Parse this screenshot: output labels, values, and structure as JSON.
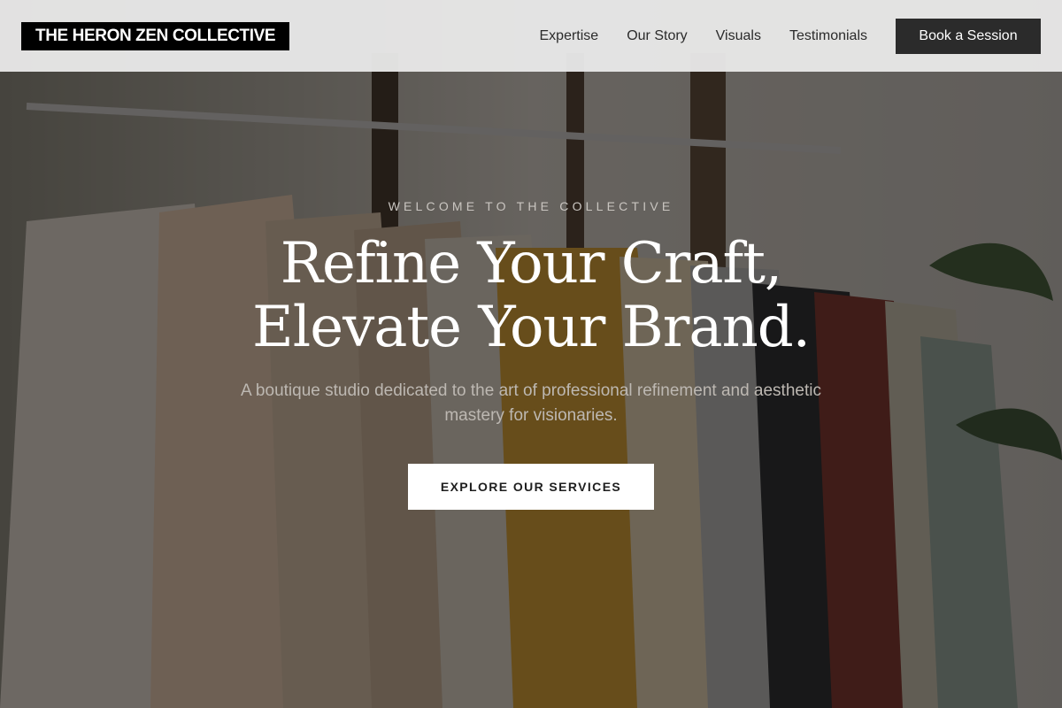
{
  "header": {
    "logo": "THE HERON ZEN COLLECTIVE",
    "nav": [
      {
        "label": "Expertise"
      },
      {
        "label": "Our Story"
      },
      {
        "label": "Visuals"
      },
      {
        "label": "Testimonials"
      }
    ],
    "cta_label": "Book a Session"
  },
  "hero": {
    "eyebrow": "WELCOME TO THE COLLECTIVE",
    "headline_line1": "Refine Your Craft,",
    "headline_line2": "Elevate Your Brand.",
    "subtitle": "A boutique studio dedicated to the art of professional refinement and aesthetic mastery for visionaries.",
    "cta_label": "EXPLORE OUR SERVICES"
  },
  "colors": {
    "header_bg": "#e8e8e8",
    "logo_bg": "#000000",
    "button_dark": "#2b2b2b",
    "cta_bg": "#ffffff"
  }
}
